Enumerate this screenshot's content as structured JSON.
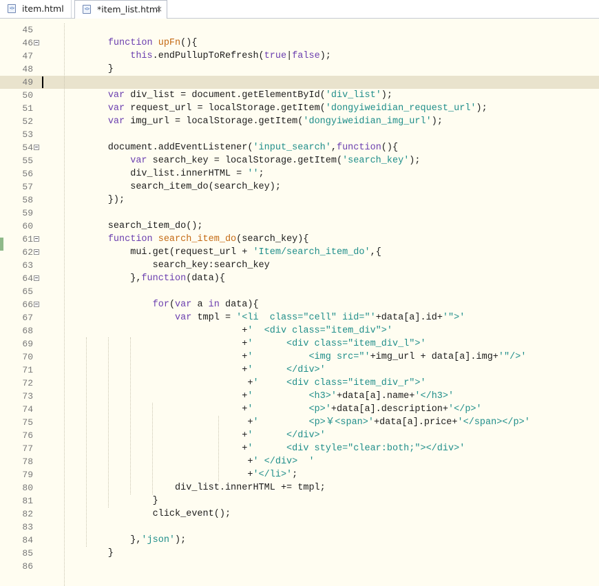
{
  "tabs": [
    {
      "label": "item.html",
      "active": false
    },
    {
      "label": "*item_list.html",
      "active": true,
      "close_icon": "close-x-icon"
    }
  ],
  "editor": {
    "current_line": 49,
    "lines": [
      {
        "n": "45",
        "fold": false,
        "code": ""
      },
      {
        "n": "46",
        "fold": true,
        "code": "        function upFn(){"
      },
      {
        "n": "47",
        "fold": false,
        "code": "            this.endPullupToRefresh(true|false);"
      },
      {
        "n": "48",
        "fold": false,
        "code": "        }"
      },
      {
        "n": "49",
        "fold": false,
        "code": ""
      },
      {
        "n": "50",
        "fold": false,
        "code": "        var div_list = document.getElementById('div_list');"
      },
      {
        "n": "51",
        "fold": false,
        "code": "        var request_url = localStorage.getItem('dongyiweidian_request_url');"
      },
      {
        "n": "52",
        "fold": false,
        "code": "        var img_url = localStorage.getItem('dongyiweidian_img_url');"
      },
      {
        "n": "53",
        "fold": false,
        "code": ""
      },
      {
        "n": "54",
        "fold": true,
        "code": "        document.addEventListener('input_search',function(){"
      },
      {
        "n": "55",
        "fold": false,
        "code": "            var search_key = localStorage.getItem('search_key');"
      },
      {
        "n": "56",
        "fold": false,
        "code": "            div_list.innerHTML = '';"
      },
      {
        "n": "57",
        "fold": false,
        "code": "            search_item_do(search_key);"
      },
      {
        "n": "58",
        "fold": false,
        "code": "        });"
      },
      {
        "n": "59",
        "fold": false,
        "code": ""
      },
      {
        "n": "60",
        "fold": false,
        "code": "        search_item_do();"
      },
      {
        "n": "61",
        "fold": true,
        "code": "        function search_item_do(search_key){"
      },
      {
        "n": "62",
        "fold": true,
        "code": "            mui.get(request_url + 'Item/search_item_do',{"
      },
      {
        "n": "63",
        "fold": false,
        "code": "                search_key:search_key"
      },
      {
        "n": "64",
        "fold": true,
        "code": "            },function(data){"
      },
      {
        "n": "65",
        "fold": false,
        "code": ""
      },
      {
        "n": "66",
        "fold": true,
        "code": "                for(var a in data){"
      },
      {
        "n": "67",
        "fold": false,
        "code": "                    var tmpl = '<li  class=\"cell\" iid=\"'+data[a].id+'\">'"
      },
      {
        "n": "68",
        "fold": false,
        "code": "                                +'  <div class=\"item_div\">'"
      },
      {
        "n": "69",
        "fold": false,
        "code": "                                +'      <div class=\"item_div_l\">'"
      },
      {
        "n": "70",
        "fold": false,
        "code": "                                +'          <img src=\"'+img_url + data[a].img+'\"/>'"
      },
      {
        "n": "71",
        "fold": false,
        "code": "                                +'      </div>'"
      },
      {
        "n": "72",
        "fold": false,
        "code": "                                 +'     <div class=\"item_div_r\">'"
      },
      {
        "n": "73",
        "fold": false,
        "code": "                                +'          <h3>'+data[a].name+'</h3>'"
      },
      {
        "n": "74",
        "fold": false,
        "code": "                                +'          <p>'+data[a].description+'</p>'"
      },
      {
        "n": "75",
        "fold": false,
        "code": "                                 +'         <p>￥<span>'+data[a].price+'</span></p>'"
      },
      {
        "n": "76",
        "fold": false,
        "code": "                                +'      </div>'"
      },
      {
        "n": "77",
        "fold": false,
        "code": "                                +'      <div style=\"clear:both;\"></div>'"
      },
      {
        "n": "78",
        "fold": false,
        "code": "                                 +' </div>  '"
      },
      {
        "n": "79",
        "fold": false,
        "code": "                                 +'</li>';"
      },
      {
        "n": "80",
        "fold": false,
        "code": "                    div_list.innerHTML += tmpl;"
      },
      {
        "n": "81",
        "fold": false,
        "code": "                }"
      },
      {
        "n": "82",
        "fold": false,
        "code": "                click_event();"
      },
      {
        "n": "83",
        "fold": false,
        "code": ""
      },
      {
        "n": "84",
        "fold": false,
        "code": "            },'json');"
      },
      {
        "n": "85",
        "fold": false,
        "code": "        }"
      },
      {
        "n": "86",
        "fold": false,
        "code": ""
      }
    ]
  },
  "colors": {
    "background": "#fffdf1",
    "current_line": "#e9e3cd",
    "keyword": "#6b3faf",
    "function_name": "#c46a14",
    "string": "#1f8e8a",
    "line_number": "#787878"
  }
}
